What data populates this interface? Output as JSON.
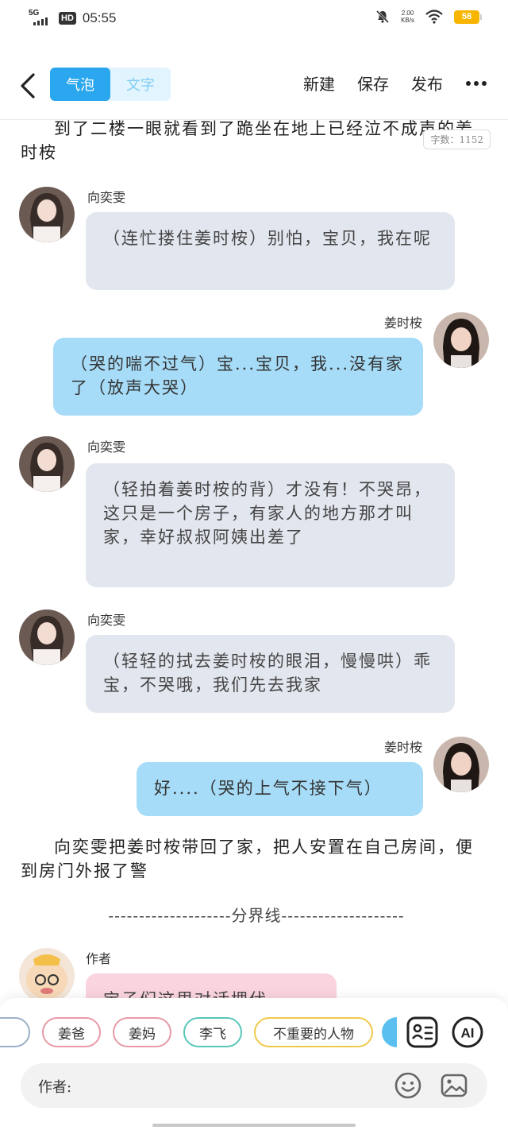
{
  "status_bar": {
    "network": "5G",
    "hd": "HD",
    "time": "05:55",
    "speed_value": "2.00",
    "speed_unit": "KB/s",
    "battery": "58"
  },
  "toolbar": {
    "mode_bubble": "气泡",
    "mode_text": "文字",
    "new_label": "新建",
    "save_label": "保存",
    "publish_label": "发布"
  },
  "word_count": "字数：1152",
  "narration_top": "到了二楼一眼就看到了跪坐在地上已经泣不成声的姜时桉",
  "messages": [
    {
      "side": "left",
      "name": "向奕雯",
      "text": "（连忙搂住姜时桉）别怕，宝贝，我在呢"
    },
    {
      "side": "right",
      "name": "姜时桉",
      "text": "（哭的喘不过气）宝...宝贝，我...没有家了（放声大哭）"
    },
    {
      "side": "left",
      "name": "向奕雯",
      "text": "（轻拍着姜时桉的背）才没有！不哭昂，这只是一个房子，有家人的地方那才叫家，幸好叔叔阿姨出差了"
    },
    {
      "side": "left",
      "name": "向奕雯",
      "text": "（轻轻的拭去姜时桉的眼泪，慢慢哄）乖宝，不哭哦，我们先去我家"
    },
    {
      "side": "right",
      "name": "姜时桉",
      "text": "好....（哭的上气不接下气）"
    }
  ],
  "narration_bottom": "向奕雯把姜时桉带回了家，把人安置在自己房间，便到房门外报了警",
  "separator": "--------------------分界线--------------------",
  "author_msg": {
    "name": "作者",
    "text": "宝子们这里对话埋伏"
  },
  "chips": [
    "姜爸",
    "姜妈",
    "李飞",
    "不重要的人物"
  ],
  "chip_colors": [
    "#e89aa6",
    "#e89aa6",
    "#57c7b8",
    "#f0c94a"
  ],
  "input": {
    "label": "作者:"
  },
  "icons": {
    "back": "back-arrow-icon",
    "more": "more-dots-icon",
    "role": "role-card-icon",
    "ai": "ai-icon",
    "emoji": "emoji-icon",
    "image": "image-icon"
  }
}
